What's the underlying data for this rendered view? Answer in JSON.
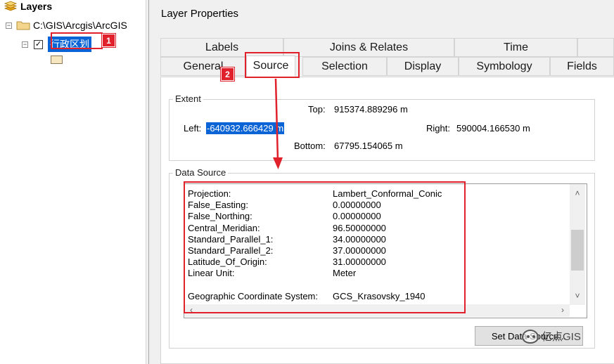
{
  "toc": {
    "root_label": "Layers",
    "folder_label": "C:\\GIS\\Arcgis\\ArcGIS",
    "layer_label": "行政区划",
    "layer_checked": "✓",
    "expander_minus": "−"
  },
  "dialog": {
    "title": "Layer Properties",
    "tabs_row1": [
      "Labels",
      "Joins & Relates",
      "Time"
    ],
    "tabs_row2": [
      "General",
      "Source",
      "Selection",
      "Display",
      "Symbology",
      "Fields"
    ],
    "active_tab": "Source"
  },
  "extent": {
    "group_label": "Extent",
    "top_label": "Top:",
    "top_value": "915374.889296 m",
    "left_label": "Left:",
    "left_value": "-640932.666429 m",
    "right_label": "Right:",
    "right_value": "590004.166530 m",
    "bottom_label": "Bottom:",
    "bottom_value": "67795.154065 m"
  },
  "data_source": {
    "group_label": "Data Source",
    "rows": [
      {
        "key": "Projection:",
        "value": "Lambert_Conformal_Conic"
      },
      {
        "key": "False_Easting:",
        "value": "0.00000000"
      },
      {
        "key": "False_Northing:",
        "value": "0.00000000"
      },
      {
        "key": "Central_Meridian:",
        "value": "96.50000000"
      },
      {
        "key": "Standard_Parallel_1:",
        "value": "34.00000000"
      },
      {
        "key": "Standard_Parallel_2:",
        "value": "37.00000000"
      },
      {
        "key": "Latitude_Of_Origin:",
        "value": "31.00000000"
      },
      {
        "key": "Linear Unit:",
        "value": "Meter"
      },
      {
        "key": "",
        "value": ""
      },
      {
        "key": "Geographic Coordinate System:",
        "value": "GCS_Krasovsky_1940"
      }
    ],
    "set_button": "Set Data Source..."
  },
  "annotations": {
    "badge1": "1",
    "badge2": "2"
  },
  "watermark": "亿点GIS",
  "colors": {
    "annotation_red": "#e0202a",
    "selection_blue": "#0a64d6"
  }
}
